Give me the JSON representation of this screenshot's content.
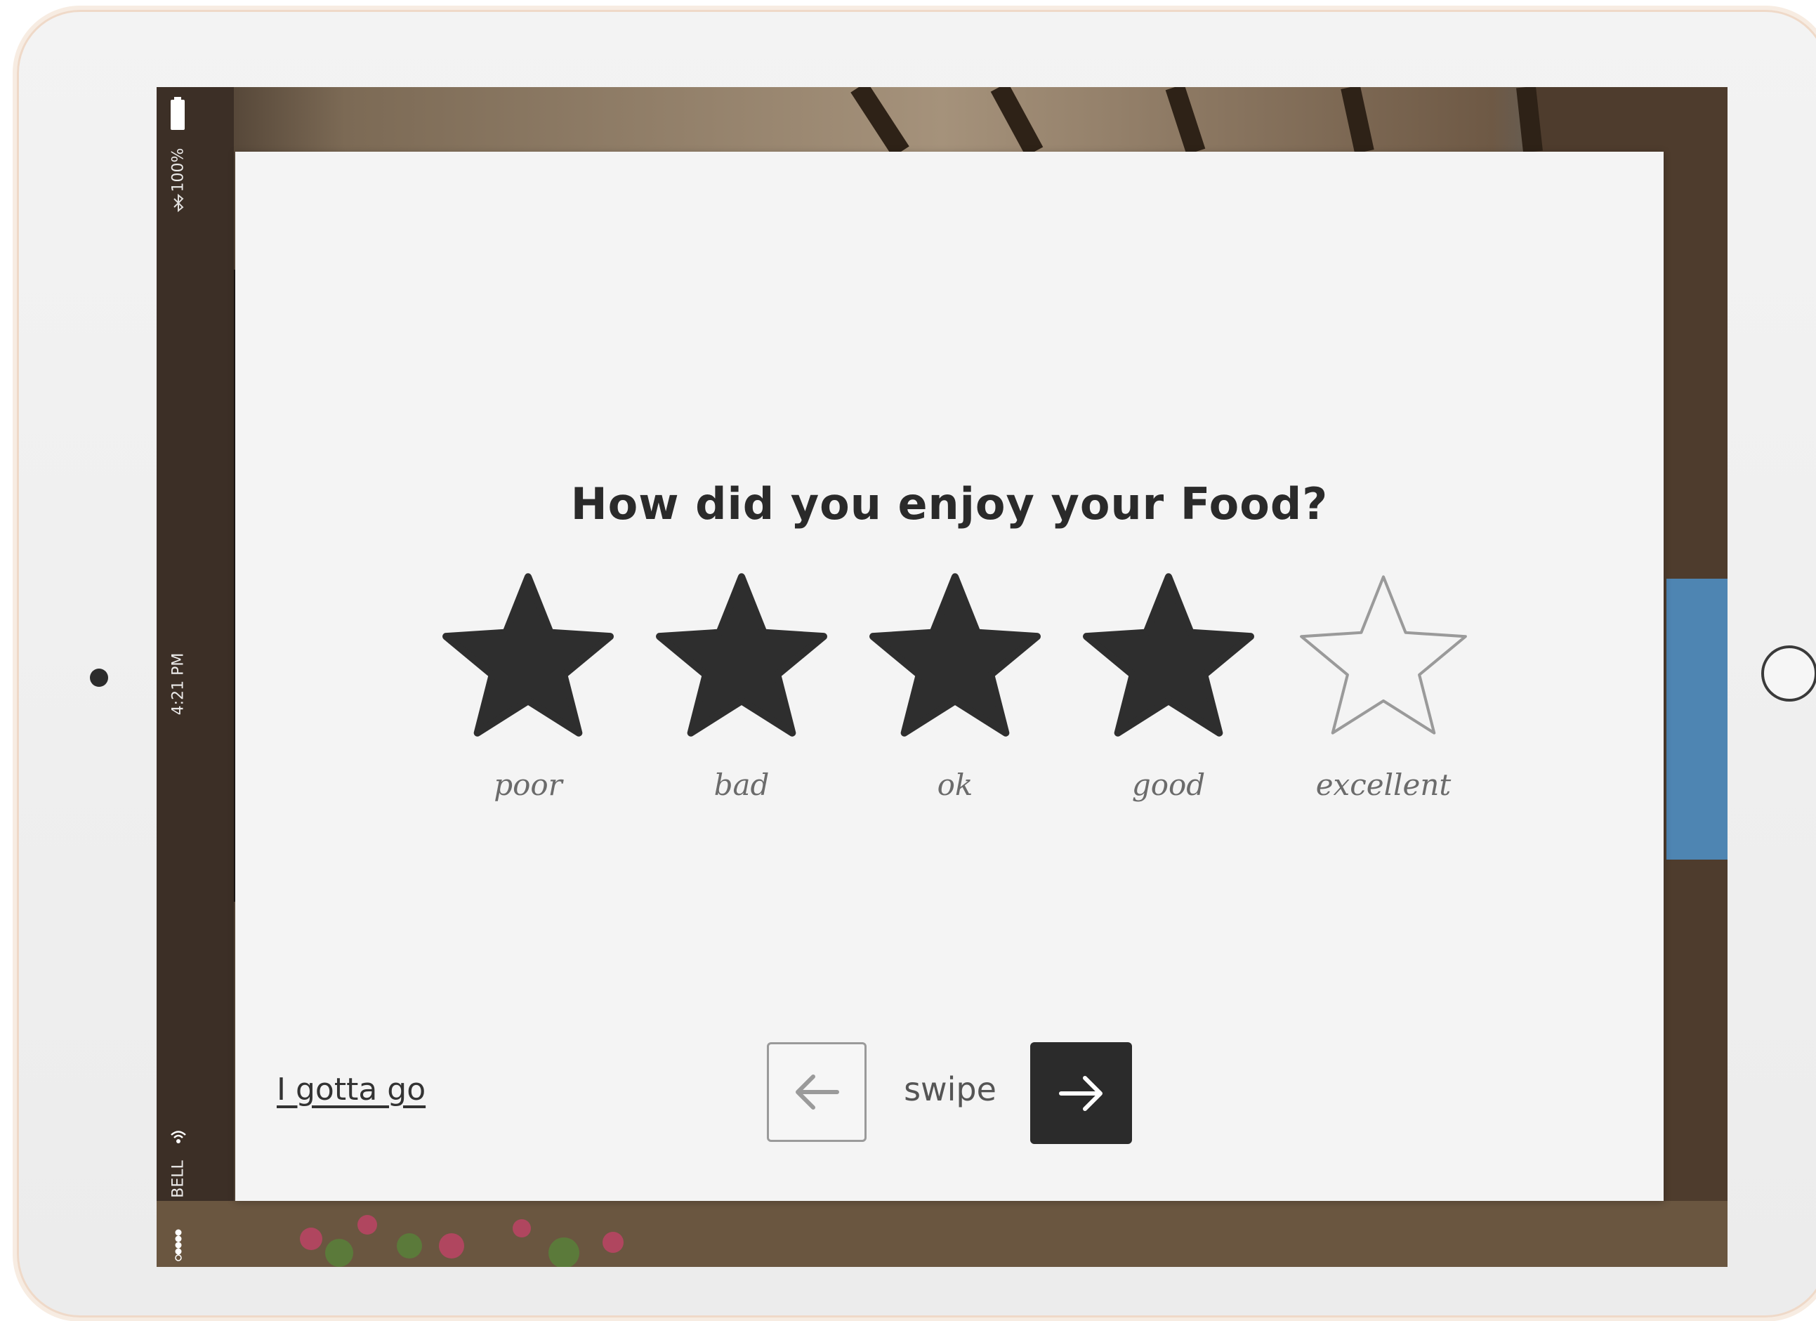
{
  "status_bar": {
    "battery": "100%",
    "time": "4:21 PM",
    "carrier": "BELL"
  },
  "survey": {
    "question": "How did you enjoy your Food?",
    "rating": {
      "value": 4,
      "max": 5,
      "labels": [
        "poor",
        "bad",
        "ok",
        "good",
        "excellent"
      ]
    },
    "leave_link": "I gotta go",
    "swipe_label": "swipe"
  },
  "colors": {
    "star_filled": "#2e2e2e",
    "star_empty_stroke": "#9a9a9a",
    "card_background": "#f4f4f4",
    "next_button": "#2b2b2b"
  },
  "icons": {
    "prev": "arrow-left-icon",
    "next": "arrow-right-icon"
  }
}
